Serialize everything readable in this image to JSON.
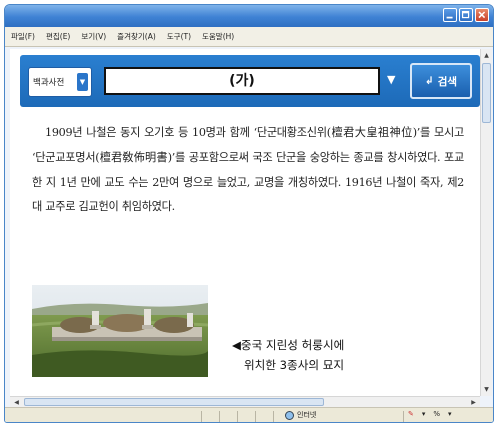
{
  "menu": [
    "파일(F)",
    "편집(E)",
    "보기(V)",
    "즐겨찾기(A)",
    "도구(T)",
    "도움말(H)"
  ],
  "search": {
    "category": "백과사전",
    "category_arrow": "▼",
    "query": "(가)",
    "query_arrow": "▼",
    "button_icon": "↲",
    "button_label": "검색"
  },
  "article": {
    "text": "1909년 나철은 동지 오기호 등 10명과 함께 ‘단군대황조신위(檀君大皇祖神位)’를 모시고 ‘단군교포명서(檀君敎佈明書)’를 공포함으로써 국조 단군을 숭앙하는 종교를 창시하였다. 포교한 지 1년 만에 교도 수는 2만여 명으로 늘었고, 교명을 개칭하였다. 1916년 나철이 죽자, 제2대 교주로 김교헌이 취임하였다."
  },
  "caption": {
    "line1": "◀중국  지린성  허룽시에",
    "line2": "위치한 3종사의 묘지"
  },
  "status": {
    "zone": "인터넷",
    "zoom": "%"
  },
  "colors": {
    "title_bar": "#3f82d4",
    "search_band": "#1d6ab8",
    "search_button": "#1a5fae"
  }
}
